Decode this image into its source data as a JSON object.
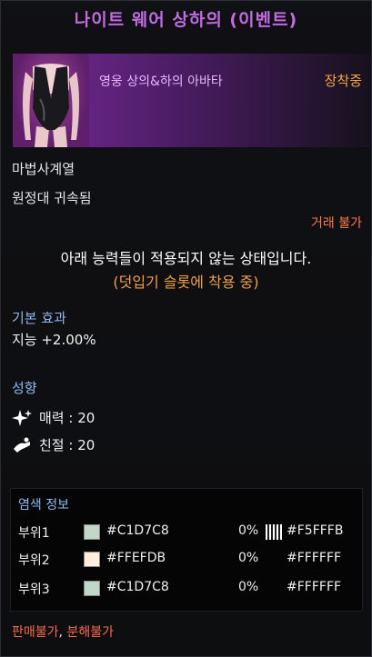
{
  "tooltip": {
    "title": "나이트 웨어 상하의 (이벤트)",
    "item_name": "영웅 상의&하의 아바타",
    "equipped_label": "장착중",
    "class_line": "마법사계열",
    "bind_line": "원정대 귀속됨",
    "trade_line": "거래 불가",
    "notice_line1": "아래 능력들이 적용되지 않는 상태입니다.",
    "notice_line2": "(덧입기 슬롯에 착용 중)",
    "basic_effect_header": "기본 효과",
    "basic_effect_value": "지능 +2.00%",
    "trait_header": "성향",
    "traits": [
      {
        "icon": "sparkle-icon",
        "label": "매력 : 20"
      },
      {
        "icon": "handshake-icon",
        "label": "친절 : 20"
      }
    ],
    "dye": {
      "header": "염색 정보",
      "rows": [
        {
          "part": "부위1",
          "color1": "#C1D7C8",
          "hex1": "#C1D7C8",
          "pct": "0%",
          "color2": "#F5FFFB",
          "hex2": "#F5FFFB",
          "pattern": true
        },
        {
          "part": "부위2",
          "color1": "#FFEFDB",
          "hex1": "#FFEFDB",
          "pct": "0%",
          "color2": "#FFFFFF",
          "hex2": "#FFFFFF",
          "pattern": false
        },
        {
          "part": "부위3",
          "color1": "#C1D7C8",
          "hex1": "#C1D7C8",
          "pct": "0%",
          "color2": "#FFFFFF",
          "hex2": "#FFFFFF",
          "pattern": false
        }
      ]
    },
    "footer_sell": "판매불가",
    "footer_sep": ", ",
    "footer_disassemble": "분해불가",
    "colors": {
      "title": "#C06BE0",
      "equipped": "#F2A640",
      "warning": "#FF7A4F",
      "section": "#8FBAF0"
    }
  }
}
